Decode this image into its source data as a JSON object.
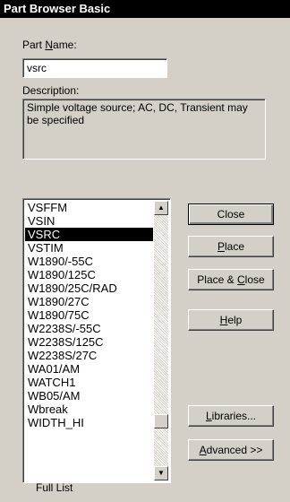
{
  "window": {
    "title": "Part Browser Basic"
  },
  "part_name": {
    "label": "Part Name:",
    "label_pre": "Part ",
    "label_underlined": "N",
    "label_post": "ame:",
    "value": "vsrc"
  },
  "description": {
    "label": "Description:",
    "text": "Simple voltage source; AC, DC, Transient may be specified"
  },
  "parts_list": {
    "items": [
      "VSFFM",
      "VSIN",
      "VSRC",
      "VSTIM",
      "W1890/-55C",
      "W1890/125C",
      "W1890/25C/RAD",
      "W1890/27C",
      "W1890/75C",
      "W2238S/-55C",
      "W2238S/125C",
      "W2238S/27C",
      "WA01/AM",
      "WATCH1",
      "WB05/AM",
      "Wbreak",
      "WIDTH_HI"
    ],
    "selected": "VSRC"
  },
  "buttons": {
    "close": {
      "label": "Close"
    },
    "place": {
      "label": "Place",
      "pre": "",
      "u": "P",
      "post": "lace"
    },
    "place_close": {
      "label": "Place & Close",
      "pre": "Place & ",
      "u": "C",
      "post": "lose"
    },
    "help": {
      "label": "Help",
      "pre": "",
      "u": "H",
      "post": "elp"
    },
    "libraries": {
      "label": "Libraries...",
      "pre": "",
      "u": "L",
      "post": "ibraries..."
    },
    "advanced": {
      "label": "Advanced >>",
      "pre": "",
      "u": "A",
      "post": "dvanced >>"
    }
  },
  "footer": {
    "status": "Full List"
  },
  "icons": {
    "scroll_up": "arrow-up-icon",
    "scroll_down": "arrow-down-icon"
  }
}
